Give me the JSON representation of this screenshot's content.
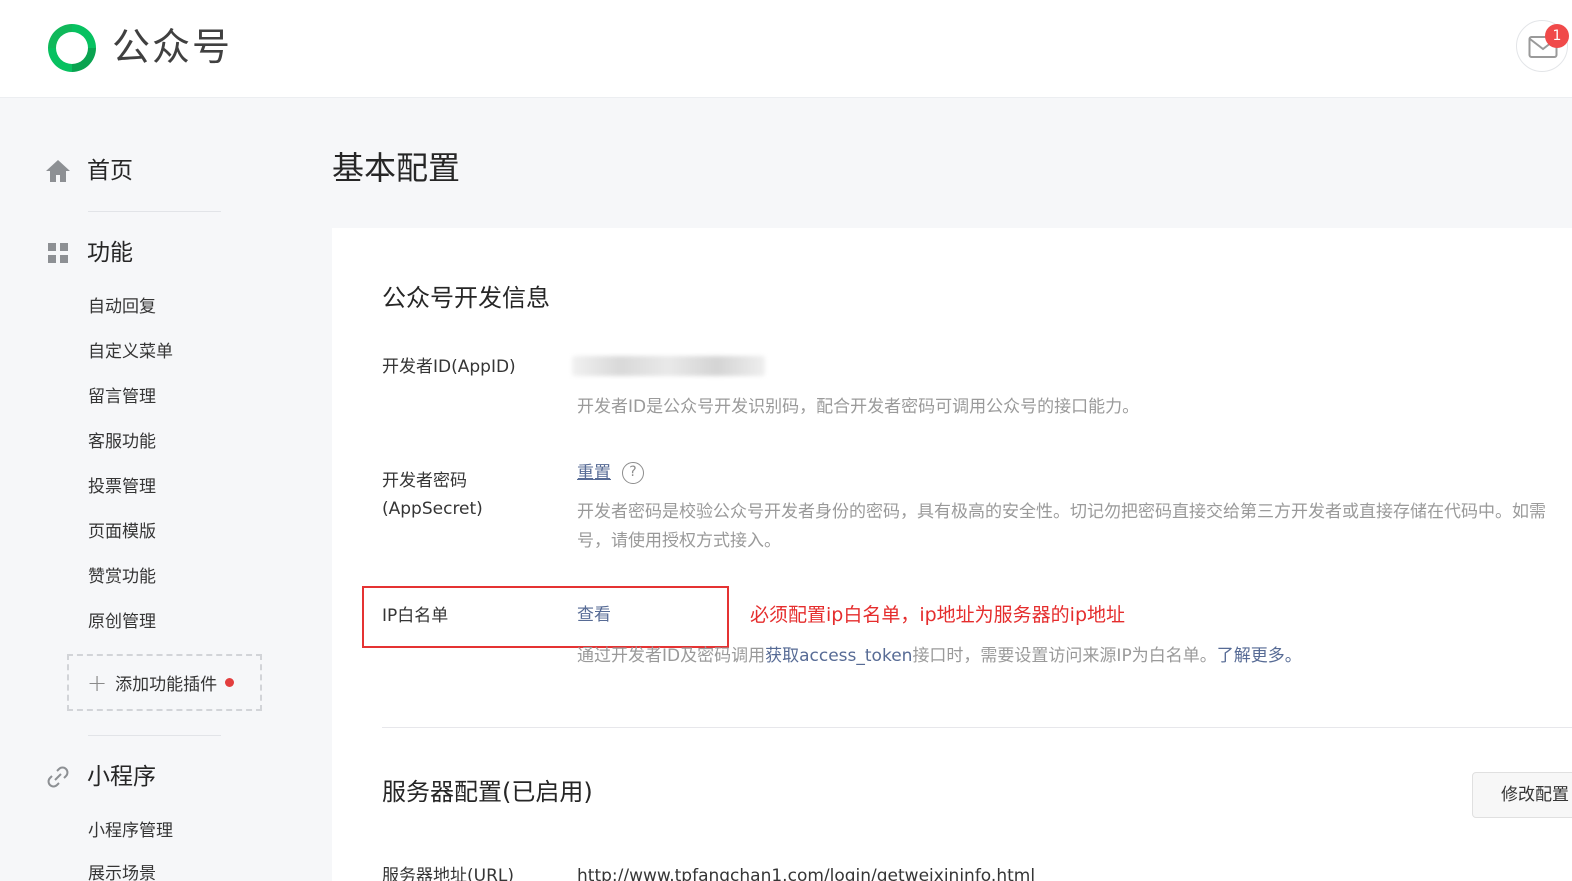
{
  "header": {
    "brand": "公众号",
    "mail_badge": "1",
    "brand_color": "#07c160"
  },
  "sidebar": {
    "home": {
      "label": "首页",
      "icon": "home-icon"
    },
    "features": {
      "label": "功能",
      "icon": "grid-icon",
      "items": [
        "自动回复",
        "自定义菜单",
        "留言管理",
        "客服功能",
        "投票管理",
        "页面模版",
        "赞赏功能",
        "原创管理"
      ],
      "add_plugin": "添加功能插件"
    },
    "miniprogram": {
      "label": "小程序",
      "icon": "link-icon",
      "items": [
        "小程序管理",
        "展示场景"
      ]
    }
  },
  "main": {
    "page_title": "基本配置",
    "dev_info": {
      "title": "公众号开发信息",
      "appid_label": "开发者ID(AppID)",
      "appid_desc": "开发者ID是公众号开发识别码，配合开发者密码可调用公众号的接口能力。",
      "secret_label_1": "开发者密码",
      "secret_label_2": "(AppSecret)",
      "secret_reset": "重置",
      "secret_desc_1": "开发者密码是校验公众号开发者身份的密码，具有极高的安全性。切记勿把密码直接交给第三方开发者或直接存储在代码中。如需",
      "secret_desc_2": "号，请使用授权方式接入。",
      "ip_label": "IP白名单",
      "ip_view": "查看",
      "ip_desc_pre": "通过开发者ID及密码调用",
      "ip_desc_link": "获取access_token",
      "ip_desc_mid": "接口时，需要设置访问来源IP为白名单。",
      "ip_desc_more": "了解更多。",
      "annotation": "必须配置ip白名单，ip地址为服务器的ip地址"
    },
    "server": {
      "title": "服务器配置(已启用)",
      "edit_button": "修改配置",
      "url_label": "服务器地址(URL)",
      "url_value": "http://www.tpfangchan1.com/login/getweixininfo.html"
    }
  }
}
